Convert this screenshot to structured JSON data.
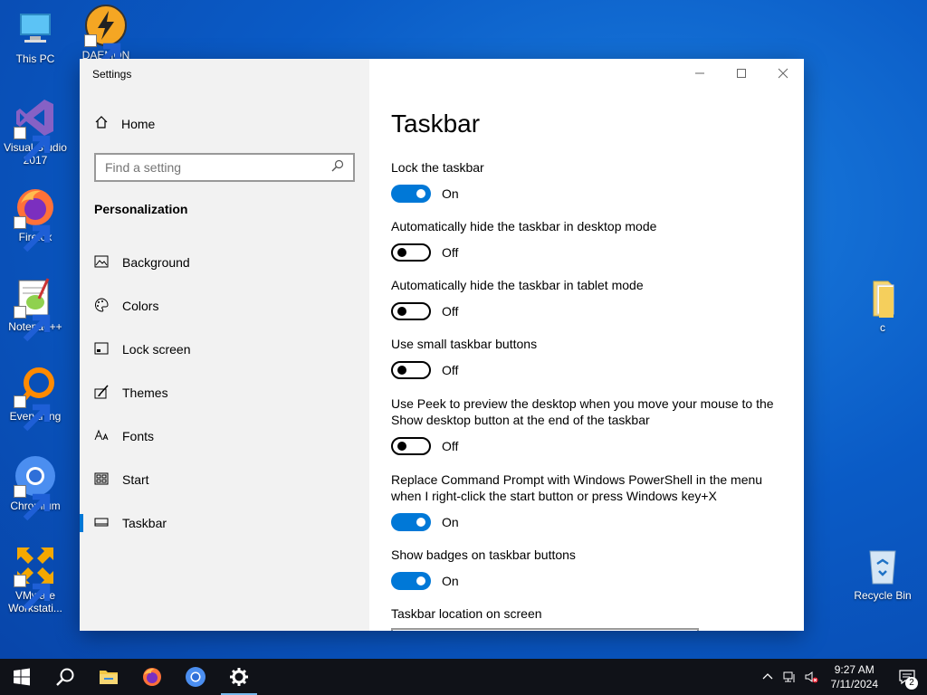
{
  "desktop": {
    "icons": [
      {
        "label": "This PC"
      },
      {
        "label": "DAEMON"
      },
      {
        "label": "Visual Studio 2017"
      },
      {
        "label": "Firefox"
      },
      {
        "label": "Notepad++"
      },
      {
        "label": "Everything"
      },
      {
        "label": "Chromium"
      },
      {
        "label": "VMware Workstati..."
      },
      {
        "label": "c"
      },
      {
        "label": "Recycle Bin"
      }
    ]
  },
  "window": {
    "title": "Settings",
    "sidebar": {
      "home": "Home",
      "search_placeholder": "Find a setting",
      "section": "Personalization",
      "items": [
        {
          "label": "Background",
          "icon": "picture-icon"
        },
        {
          "label": "Colors",
          "icon": "palette-icon"
        },
        {
          "label": "Lock screen",
          "icon": "lock-screen-icon"
        },
        {
          "label": "Themes",
          "icon": "themes-brush-icon"
        },
        {
          "label": "Fonts",
          "icon": "fonts-icon"
        },
        {
          "label": "Start",
          "icon": "start-icon"
        },
        {
          "label": "Taskbar",
          "icon": "taskbar-icon",
          "active": true
        }
      ]
    },
    "content": {
      "title": "Taskbar",
      "settings": [
        {
          "label": "Lock the taskbar",
          "state": "On",
          "on": true
        },
        {
          "label": "Automatically hide the taskbar in desktop mode",
          "state": "Off",
          "on": false
        },
        {
          "label": "Automatically hide the taskbar in tablet mode",
          "state": "Off",
          "on": false
        },
        {
          "label": "Use small taskbar buttons",
          "state": "Off",
          "on": false
        },
        {
          "label": "Use Peek to preview the desktop when you move your mouse to the Show desktop button at the end of the taskbar",
          "state": "Off",
          "on": false
        },
        {
          "label": "Replace Command Prompt with Windows PowerShell in the menu when I right-click the start button or press Windows key+X",
          "state": "On",
          "on": true
        },
        {
          "label": "Show badges on taskbar buttons",
          "state": "On",
          "on": true
        },
        {
          "label": "Taskbar location on screen"
        }
      ]
    }
  },
  "taskbar": {
    "time": "9:27 AM",
    "date": "7/11/2024",
    "notification_count": "2"
  },
  "colors": {
    "accent": "#0078d7",
    "taskbar": "#101218"
  }
}
